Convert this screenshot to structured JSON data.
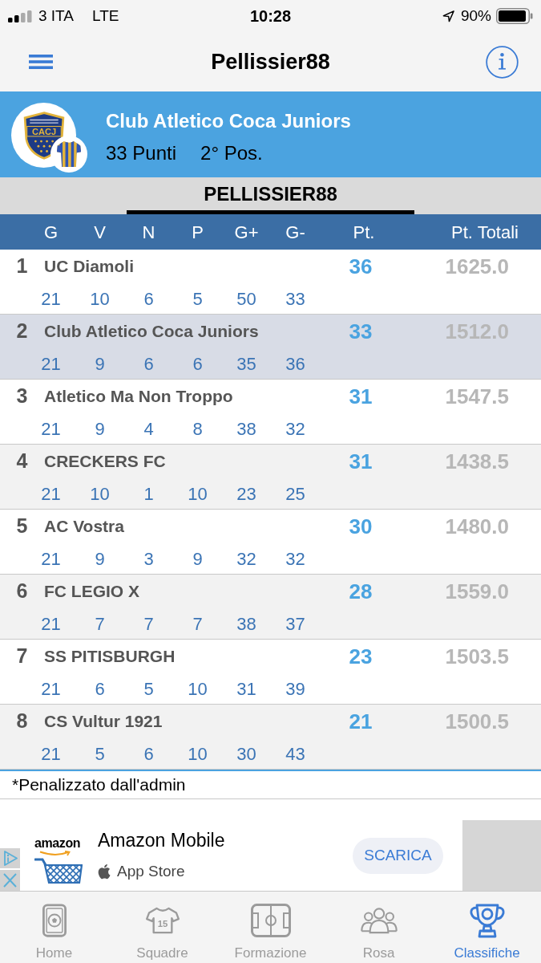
{
  "status_bar": {
    "carrier": "3 ITA",
    "network": "LTE",
    "time": "10:28",
    "battery": "90%"
  },
  "nav_bar": {
    "title": "Pellissier88"
  },
  "team_header": {
    "crest_text": "CACJ",
    "name": "Club Atletico Coca Juniors",
    "points": "33 Punti",
    "position": "2° Pos."
  },
  "tabs": [
    {
      "label": "PELLISSIER88",
      "selected": true
    }
  ],
  "table": {
    "columns": [
      "G",
      "V",
      "N",
      "P",
      "G+",
      "G-",
      "Pt.",
      "Pt. Totali"
    ],
    "rows": [
      {
        "rank": "1",
        "team": "UC Diamoli",
        "stats": [
          "21",
          "10",
          "6",
          "5",
          "50",
          "33"
        ],
        "points": "36",
        "total": "1625.0",
        "selected": false
      },
      {
        "rank": "2",
        "team": "Club Atletico Coca Juniors",
        "stats": [
          "21",
          "9",
          "6",
          "6",
          "35",
          "36"
        ],
        "points": "33",
        "total": "1512.0",
        "selected": true
      },
      {
        "rank": "3",
        "team": "Atletico Ma Non Troppo",
        "stats": [
          "21",
          "9",
          "4",
          "8",
          "38",
          "32"
        ],
        "points": "31",
        "total": "1547.5",
        "selected": false
      },
      {
        "rank": "4",
        "team": "CRECKERS FC",
        "stats": [
          "21",
          "10",
          "1",
          "10",
          "23",
          "25"
        ],
        "points": "31",
        "total": "1438.5",
        "selected": false
      },
      {
        "rank": "5",
        "team": "AC Vostra",
        "stats": [
          "21",
          "9",
          "3",
          "9",
          "32",
          "32"
        ],
        "points": "30",
        "total": "1480.0",
        "selected": false
      },
      {
        "rank": "6",
        "team": "FC LEGIO X",
        "stats": [
          "21",
          "7",
          "7",
          "7",
          "38",
          "37"
        ],
        "points": "28",
        "total": "1559.0",
        "selected": false
      },
      {
        "rank": "7",
        "team": "SS PITISBURGH",
        "stats": [
          "21",
          "6",
          "5",
          "10",
          "31",
          "39"
        ],
        "points": "23",
        "total": "1503.5",
        "selected": false
      },
      {
        "rank": "8",
        "team": "CS Vultur 1921",
        "stats": [
          "21",
          "5",
          "6",
          "10",
          "30",
          "43"
        ],
        "points": "21",
        "total": "1500.5",
        "selected": false
      }
    ]
  },
  "footnote": "*Penalizzato dall'admin",
  "ad": {
    "brand": "amazon",
    "title": "Amazon Mobile",
    "store": "App Store",
    "button": "SCARICA"
  },
  "bottom_tabs": [
    {
      "label": "Home",
      "selected": false
    },
    {
      "label": "Squadre",
      "jersey_number": "15",
      "selected": false
    },
    {
      "label": "Formazione",
      "selected": false
    },
    {
      "label": "Rosa",
      "selected": false
    },
    {
      "label": "Classifiche",
      "selected": true
    }
  ]
}
